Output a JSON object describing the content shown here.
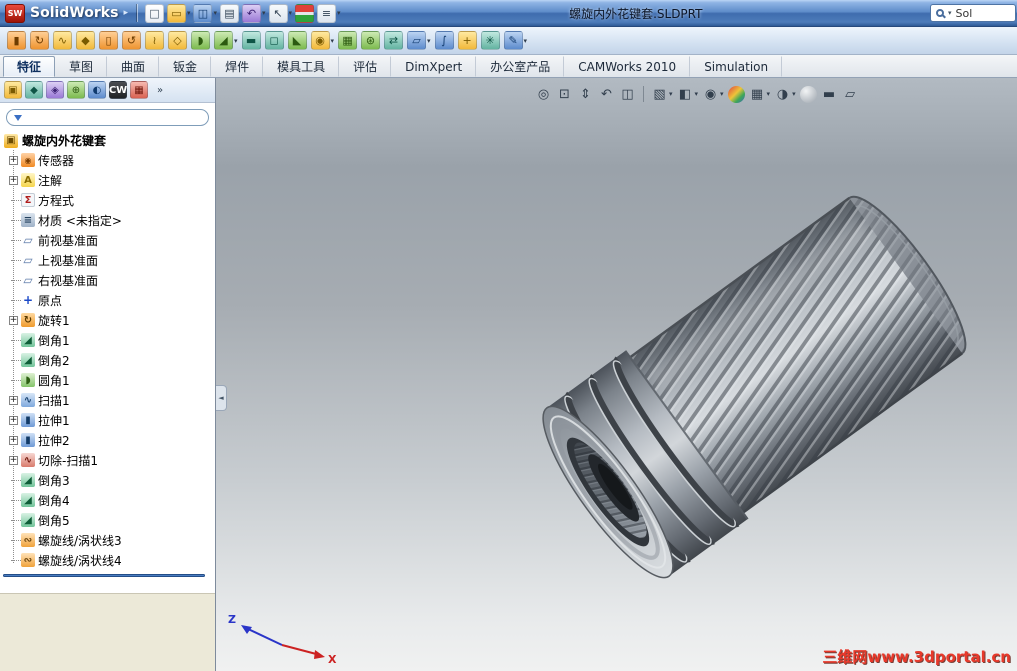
{
  "titlebar": {
    "app_icon": "SW",
    "app_name": "SolidWorks",
    "menu_arrow": "▸",
    "document_title": "螺旋内外花键套.SLDPRT",
    "search_dd": "▾",
    "search_text": "Sol",
    "icons": [
      {
        "name": "new-document-icon",
        "glyph": "□",
        "cls": "t-white"
      },
      {
        "name": "open-icon",
        "glyph": "▭",
        "cls": "t-yellow",
        "dd": "dd"
      },
      {
        "name": "save-icon",
        "glyph": "◫",
        "cls": "t-blue",
        "dd": "dd"
      },
      {
        "name": "print-icon",
        "glyph": "▤",
        "cls": "t-light"
      },
      {
        "name": "undo-icon",
        "glyph": "↶",
        "cls": "t-purple",
        "dd": "dd"
      },
      {
        "name": "select-icon",
        "glyph": "↖",
        "cls": "t-light",
        "dd": "dd"
      },
      {
        "name": "rebuild-icon",
        "glyph": "",
        "cls": "t-traffic"
      },
      {
        "name": "options-icon",
        "glyph": "≡",
        "cls": "t-light",
        "dd": "dd"
      }
    ]
  },
  "features_toolbar": {
    "icons": [
      {
        "name": "extruded-boss-icon",
        "glyph": "▮",
        "cls": "t-orange"
      },
      {
        "name": "revolved-boss-icon",
        "glyph": "↻",
        "cls": "t-orange"
      },
      {
        "name": "swept-boss-icon",
        "glyph": "∿",
        "cls": "t-yellow"
      },
      {
        "name": "lofted-boss-icon",
        "glyph": "◆",
        "cls": "t-yellow"
      },
      {
        "name": "extruded-cut-icon",
        "glyph": "▯",
        "cls": "t-orange"
      },
      {
        "name": "revolved-cut-icon",
        "glyph": "↺",
        "cls": "t-orange"
      },
      {
        "name": "swept-cut-icon",
        "glyph": "≀",
        "cls": "t-yellow"
      },
      {
        "name": "lofted-cut-icon",
        "glyph": "◇",
        "cls": "t-yellow"
      },
      {
        "name": "fillet-icon",
        "glyph": "◗",
        "cls": "t-green"
      },
      {
        "name": "chamfer-icon",
        "glyph": "◢",
        "cls": "t-green",
        "dd": "dd"
      },
      {
        "name": "rib-icon",
        "glyph": "▬",
        "cls": "t-teal"
      },
      {
        "name": "shell-icon",
        "glyph": "◻",
        "cls": "t-teal"
      },
      {
        "name": "draft-icon",
        "glyph": "◣",
        "cls": "t-green"
      },
      {
        "name": "hole-wizard-icon",
        "glyph": "◉",
        "cls": "t-yellow",
        "dd": "dd"
      },
      {
        "name": "linear-pattern-icon",
        "glyph": "▦",
        "cls": "t-green"
      },
      {
        "name": "circular-pattern-icon",
        "glyph": "⊛",
        "cls": "t-green"
      },
      {
        "name": "mirror-icon",
        "glyph": "⇄",
        "cls": "t-teal"
      },
      {
        "name": "reference-geometry-icon",
        "glyph": "▱",
        "cls": "t-blue",
        "dd": "dd"
      },
      {
        "name": "curves-icon",
        "glyph": "∫",
        "cls": "t-blue"
      },
      {
        "name": "instant3d-icon",
        "glyph": "+",
        "cls": "t-yellow"
      },
      {
        "name": "measure-icon",
        "glyph": "✳",
        "cls": "t-teal"
      },
      {
        "name": "sketch-icon",
        "glyph": "✎",
        "cls": "t-blue",
        "dd": "dd"
      }
    ]
  },
  "command_tabs": [
    {
      "label": "特征",
      "name": "tab-features",
      "state": "active"
    },
    {
      "label": "草图",
      "name": "tab-sketch"
    },
    {
      "label": "曲面",
      "name": "tab-surfaces"
    },
    {
      "label": "钣金",
      "name": "tab-sheet-metal"
    },
    {
      "label": "焊件",
      "name": "tab-weldments"
    },
    {
      "label": "模具工具",
      "name": "tab-mold-tools"
    },
    {
      "label": "评估",
      "name": "tab-evaluate"
    },
    {
      "label": "DimXpert",
      "name": "tab-dimxpert"
    },
    {
      "label": "办公室产品",
      "name": "tab-office-products"
    },
    {
      "label": "CAMWorks 2010",
      "name": "tab-camworks-2010"
    },
    {
      "label": "Simulation",
      "name": "tab-simulation"
    }
  ],
  "panel": {
    "tabs": [
      {
        "name": "featuremanager-tab-icon",
        "glyph": "▣",
        "cls": "t-yellow"
      },
      {
        "name": "propertymanager-tab-icon",
        "glyph": "◆",
        "cls": "t-teal"
      },
      {
        "name": "configurationmanager-tab-icon",
        "glyph": "◈",
        "cls": "t-purple"
      },
      {
        "name": "dimxpertmanager-tab-icon",
        "glyph": "⊕",
        "cls": "t-green"
      },
      {
        "name": "displaymanager-tab-icon",
        "glyph": "◐",
        "cls": "t-blue"
      },
      {
        "name": "camworks-feature-tree-tab-icon",
        "glyph": "CW",
        "cls": "t-dark"
      },
      {
        "name": "camworks-operation-tree-tab-icon",
        "glyph": "▦",
        "cls": "t-red"
      },
      {
        "name": "panel-tabs-overflow-icon",
        "glyph": "»",
        "cls": "t-plain"
      }
    ],
    "tree": {
      "root": "螺旋内外花键套",
      "items": [
        {
          "label": "传感器",
          "icon_class": "ic-sensor",
          "icon_name": "sensors-folder-icon",
          "expand": "plus"
        },
        {
          "label": "注解",
          "icon_class": "ic-ann",
          "icon_name": "annotations-folder-icon",
          "expand": "plus"
        },
        {
          "label": "方程式",
          "icon_class": "ic-eq",
          "icon_name": "equations-folder-icon"
        },
        {
          "label": "材质 <未指定>",
          "icon_class": "ic-mat",
          "icon_name": "material-icon"
        },
        {
          "label": "前视基准面",
          "icon_class": "ic-plane",
          "icon_name": "front-plane-icon"
        },
        {
          "label": "上视基准面",
          "icon_class": "ic-plane",
          "icon_name": "top-plane-icon"
        },
        {
          "label": "右视基准面",
          "icon_class": "ic-plane",
          "icon_name": "right-plane-icon"
        },
        {
          "label": "原点",
          "icon_class": "ic-origin",
          "icon_name": "origin-icon"
        },
        {
          "label": "旋转1",
          "icon_class": "ic-revolve",
          "icon_name": "revolve1-feature-icon",
          "expand": "plus"
        },
        {
          "label": "倒角1",
          "icon_class": "ic-chamfer",
          "icon_name": "chamfer1-feature-icon"
        },
        {
          "label": "倒角2",
          "icon_class": "ic-chamfer",
          "icon_name": "chamfer2-feature-icon"
        },
        {
          "label": "圆角1",
          "icon_class": "ic-fillet",
          "icon_name": "fillet1-feature-icon"
        },
        {
          "label": "扫描1",
          "icon_class": "ic-sweep",
          "icon_name": "sweep1-feature-icon",
          "expand": "plus"
        },
        {
          "label": "拉伸1",
          "icon_class": "ic-extrude",
          "icon_name": "extrude1-feature-icon",
          "expand": "plus"
        },
        {
          "label": "拉伸2",
          "icon_class": "ic-extrude",
          "icon_name": "extrude2-feature-icon",
          "expand": "plus"
        },
        {
          "label": "切除-扫描1",
          "icon_class": "ic-cutsweep",
          "icon_name": "cut-sweep1-feature-icon",
          "expand": "plus"
        },
        {
          "label": "倒角3",
          "icon_class": "ic-chamfer",
          "icon_name": "chamfer3-feature-icon"
        },
        {
          "label": "倒角4",
          "icon_class": "ic-chamfer",
          "icon_name": "chamfer4-feature-icon"
        },
        {
          "label": "倒角5",
          "icon_class": "ic-chamfer",
          "icon_name": "chamfer5-feature-icon"
        },
        {
          "label": "螺旋线/涡状线3",
          "icon_class": "ic-helix",
          "icon_name": "helix-spiral3-icon"
        },
        {
          "label": "螺旋线/涡状线4",
          "icon_class": "ic-helix",
          "icon_name": "helix-spiral4-icon"
        }
      ]
    }
  },
  "headsup": {
    "group1": [
      {
        "name": "zoom-fit-icon",
        "glyph": "◎"
      },
      {
        "name": "zoom-area-icon",
        "glyph": "⊡"
      },
      {
        "name": "zoom-in-out-icon",
        "glyph": "⇕"
      },
      {
        "name": "previous-view-icon",
        "glyph": "↶"
      },
      {
        "name": "section-view-icon",
        "glyph": "◫"
      }
    ],
    "group2": [
      {
        "name": "view-orientation-icon",
        "glyph": "▧",
        "dd": "dd"
      },
      {
        "name": "display-style-icon",
        "glyph": "◧",
        "dd": "dd"
      },
      {
        "name": "hide-show-items-icon",
        "glyph": "◉",
        "dd": "dd"
      },
      {
        "name": "edit-appearance-icon",
        "glyph": "●",
        "cls": "t-rainbow"
      },
      {
        "name": "apply-scene-icon",
        "glyph": "▦",
        "dd": "dd"
      },
      {
        "name": "view-settings-icon",
        "glyph": "◑",
        "dd": "dd"
      },
      {
        "name": "realview-icon",
        "glyph": "●",
        "cls": "t-sphere"
      },
      {
        "name": "shadows-icon",
        "glyph": "▬"
      },
      {
        "name": "perspective-icon",
        "glyph": "▱"
      }
    ]
  },
  "viewport": {
    "watermark": "三维网www.3dportal.cn",
    "collapse_glyph": "◄",
    "triad": {
      "x": "X",
      "z": "Z"
    }
  }
}
